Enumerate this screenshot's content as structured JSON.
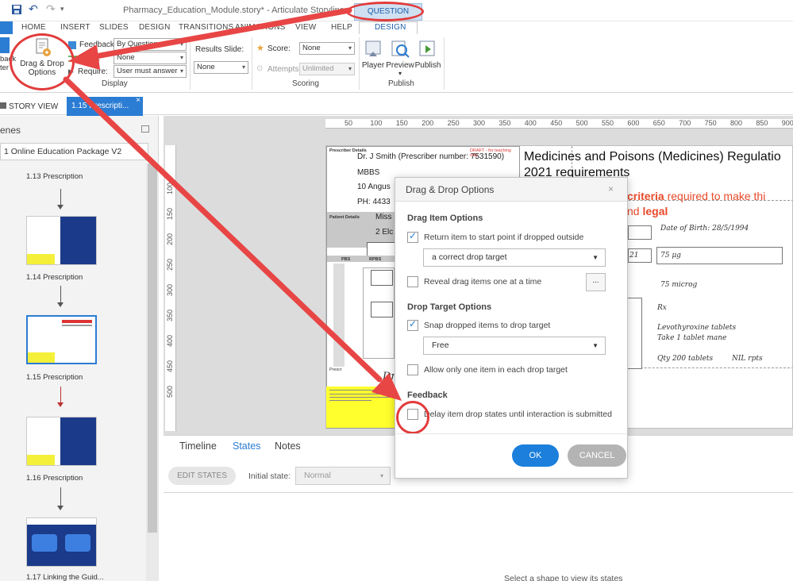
{
  "window": {
    "title": "Pharmacy_Education_Module.story* - Articulate Storyline",
    "contextual_tab_group": "QUESTION TOOLS"
  },
  "ribbon": {
    "tabs": [
      "HOME",
      "INSERT",
      "SLIDES",
      "DESIGN",
      "TRANSITIONS",
      "ANIMATIONS",
      "VIEW",
      "HELP",
      "DESIGN"
    ],
    "feedback_button": "back\nter",
    "drag_drop_button": "Drag & Drop\nOptions",
    "display": {
      "feedback_label": "Feedback:",
      "feedback_value": "By Question",
      "shuffle_label": "e:",
      "shuffle_value": "None",
      "require_label": "Require:",
      "require_value": "User must answer",
      "group_label": "Display"
    },
    "results_slide": {
      "label": "Results Slide:",
      "value": "None"
    },
    "scoring": {
      "score_label": "Score:",
      "score_value": "None",
      "attempts_label": "Attempts:",
      "attempts_value": "Unlimited",
      "group_label": "Scoring"
    },
    "publish": {
      "player": "Player",
      "preview": "Preview",
      "publish": "Publish",
      "group_label": "Publish"
    }
  },
  "story_tabs": {
    "story_view": "STORY VIEW",
    "slide_tab": "1.15 Prescripti...",
    "close": "×"
  },
  "scenes_panel": {
    "title": "enes",
    "scene_name": "1 Online Education Package V2",
    "slides": [
      {
        "label": "1.13 Prescription"
      },
      {
        "label": "1.14 Prescription"
      },
      {
        "label": "1.15 Prescription"
      },
      {
        "label": "1.16 Prescription"
      },
      {
        "label": "1.17 Linking the Guid..."
      }
    ]
  },
  "ruler": {
    "top": [
      "50",
      "100",
      "150",
      "200",
      "250",
      "300",
      "350",
      "400",
      "450",
      "500",
      "550",
      "600",
      "650",
      "700",
      "750",
      "800",
      "850",
      "900"
    ],
    "left": [
      "100",
      "150",
      "200",
      "250",
      "300",
      "350",
      "400",
      "450",
      "500"
    ]
  },
  "slide": {
    "prescriber_details": "Prescriber Details",
    "draft_note": "DRAFT - for teaching only",
    "prescriber_name": "Dr. J Smith (Prescriber number: 7531590)",
    "qualification": "MBBS",
    "address_line": "10 Angus",
    "phone": "PH: 4433",
    "patient_details": "Patient Details",
    "patient_name": "Miss",
    "patient_address": "2 Elc",
    "pbs": "PBS",
    "rpbs": "RPBS",
    "signature": "Dr.",
    "heading_line1": "Medicines and Poisons (Medicines) Regulatio",
    "heading_line2": "2021 requirements",
    "criteria_bold": "criteria",
    "criteria_rest": " required to make thi",
    "legal_prefix": "nd ",
    "legal_bold": "legal",
    "dob": "Date of Birth: 28/5/1994",
    "field_left": "21",
    "dose_box": "75 μg",
    "dose_written": "75 microg",
    "rx": "Rx",
    "drug": "Levothyroxine tablets",
    "directions": "Take 1 tablet mane",
    "qty": "Qty 200 tablets",
    "repeats": "NIL rpts"
  },
  "timeline_panel": {
    "tabs": [
      "Timeline",
      "States",
      "Notes"
    ],
    "edit_states": "EDIT STATES",
    "initial_state_label": "Initial state:",
    "initial_state_value": "Normal",
    "hint": "Select a shape to view its states"
  },
  "dialog": {
    "title": "Drag & Drop Options",
    "close": "×",
    "drag_item_section": "Drag Item Options",
    "return_item": {
      "label": "Return item to start point if dropped outside",
      "checked": true
    },
    "return_target": "a correct drop target",
    "reveal_items": {
      "label": "Reveal drag items one at a time",
      "checked": false
    },
    "ellipsis": "...",
    "drop_target_section": "Drop Target Options",
    "snap_items": {
      "label": "Snap dropped items to drop target",
      "checked": true
    },
    "snap_mode": "Free",
    "one_item": {
      "label": "Allow only one item in each drop target",
      "checked": false
    },
    "feedback_section": "Feedback",
    "delay_states": {
      "label": "Delay item drop states until interaction is submitted",
      "checked": false
    },
    "ok": "OK",
    "cancel": "CANCEL"
  },
  "colors": {
    "accent": "#2b7cd3",
    "annotation_red": "#e23b3b",
    "slide_highlight": "#e84a2a",
    "thumb_blue": "#1b3a8a"
  }
}
